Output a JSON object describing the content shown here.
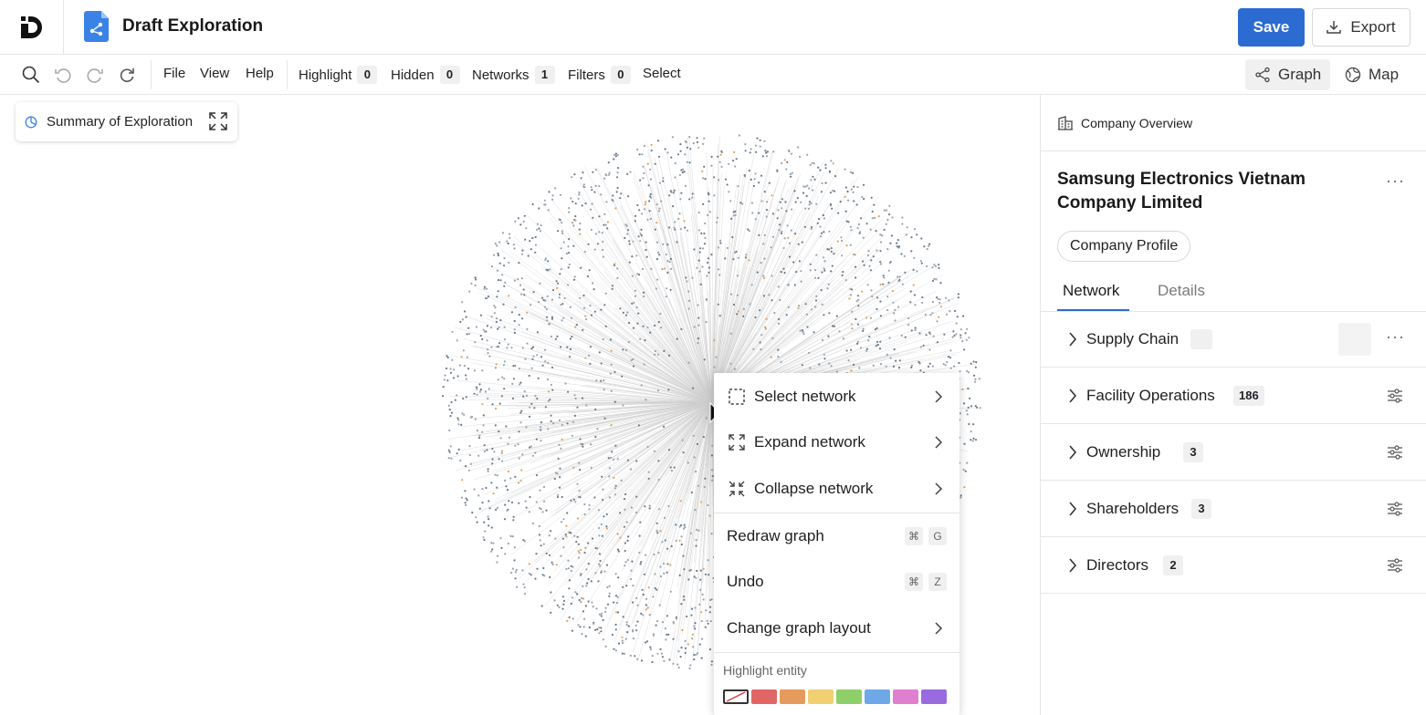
{
  "header": {
    "title": "Draft Exploration",
    "save_label": "Save",
    "export_label": "Export"
  },
  "toolbar": {
    "file": "File",
    "view": "View",
    "help": "Help",
    "highlight_label": "Highlight",
    "highlight_count": "0",
    "hidden_label": "Hidden",
    "hidden_count": "0",
    "networks_label": "Networks",
    "networks_count": "1",
    "filters_label": "Filters",
    "filters_count": "0",
    "select_label": "Select",
    "graph_label": "Graph",
    "map_label": "Map"
  },
  "summary": {
    "label": "Summary of Exploration"
  },
  "context_menu": {
    "select_network": "Select network",
    "expand_network": "Expand network",
    "collapse_network": "Collapse network",
    "redraw_graph": "Redraw graph",
    "redraw_keys": [
      "⌘",
      "G"
    ],
    "undo": "Undo",
    "undo_keys": [
      "⌘",
      "Z"
    ],
    "change_layout": "Change graph layout",
    "highlight_title": "Highlight entity",
    "swatch_colors": [
      "#none",
      "#e06666",
      "#e69a5c",
      "#f0d070",
      "#8fcf6a",
      "#6fa8e8",
      "#e07ed0",
      "#9a6be0"
    ]
  },
  "panel": {
    "header": "Company Overview",
    "company_name": "Samsung Electronics Vietnam Company Limited",
    "profile_button": "Company Profile",
    "tabs": [
      "Network",
      "Details"
    ],
    "sections": [
      {
        "label": "Supply Chain",
        "count": ""
      },
      {
        "label": "Facility Operations",
        "count": "186"
      },
      {
        "label": "Ownership",
        "count": "3"
      },
      {
        "label": "Shareholders",
        "count": "3"
      },
      {
        "label": "Directors",
        "count": "2"
      }
    ]
  }
}
